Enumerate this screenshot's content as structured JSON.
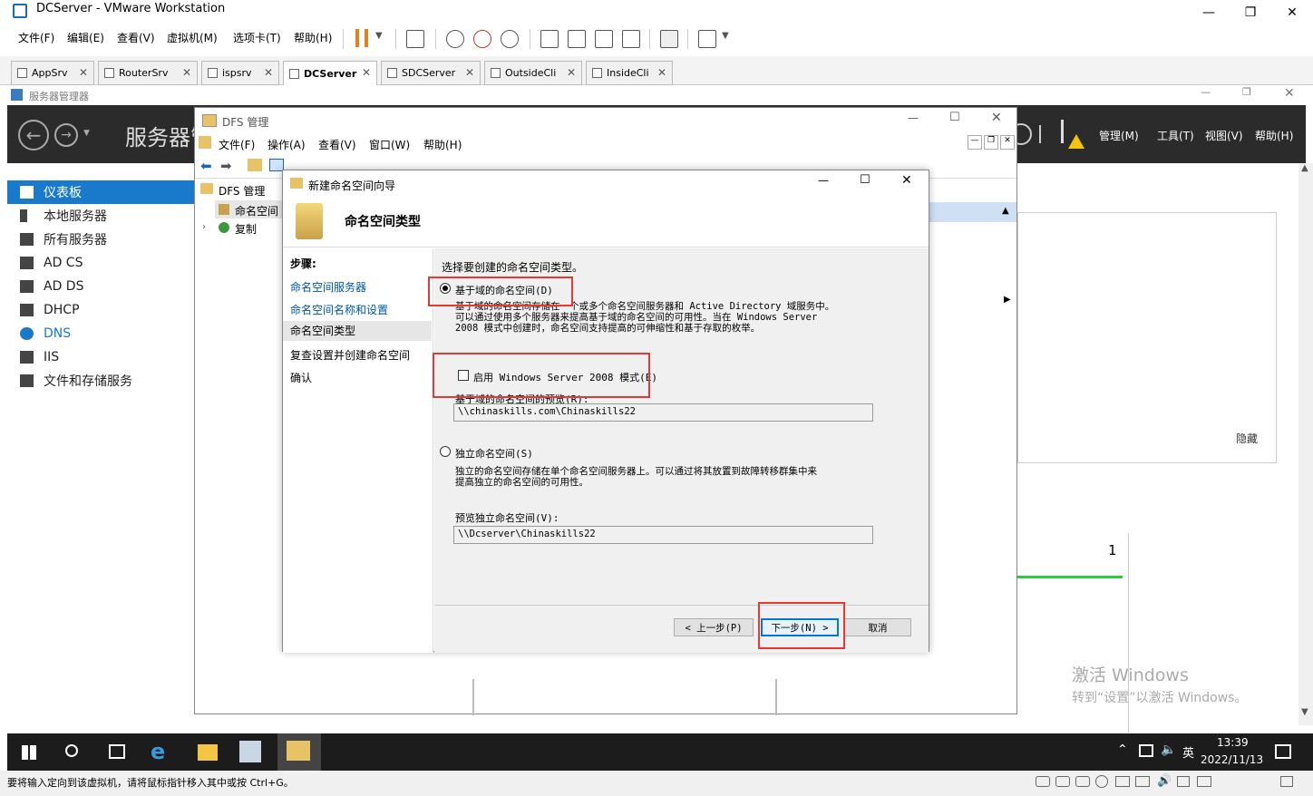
{
  "vmware": {
    "title": "DCServer - VMware Workstation",
    "menu": [
      "文件(F)",
      "编辑(E)",
      "查看(V)",
      "虚拟机(M)",
      "选项卡(T)",
      "帮助(H)"
    ],
    "tabs": [
      "AppSrv",
      "RouterSrv",
      "ispsrv",
      "DCServer",
      "SDCServer",
      "OutsideCli",
      "InsideCli"
    ],
    "active_tab": "DCServer",
    "status": "要将输入定向到该虚拟机，请将鼠标指针移入其中或按 Ctrl+G。"
  },
  "server_manager": {
    "window_title": "服务器管理器",
    "header_title": "服务器管",
    "menu": [
      "管理(M)",
      "工具(T)",
      "视图(V)",
      "帮助(H)"
    ],
    "sidebar": [
      "仪表板",
      "本地服务器",
      "所有服务器",
      "AD CS",
      "AD DS",
      "DHCP",
      "DNS",
      "IIS",
      "文件和存储服务"
    ],
    "selected": "仪表板",
    "hide_label": "隐藏",
    "count": "1"
  },
  "dfs": {
    "title": "DFS 管理",
    "menu": [
      "文件(F)",
      "操作(A)",
      "查看(V)",
      "窗口(W)",
      "帮助(H)"
    ],
    "tree": {
      "root": "DFS 管理",
      "namespace": "命名空间",
      "replication": "复制"
    }
  },
  "wizard": {
    "title": "新建命名空间向导",
    "heading": "命名空间类型",
    "steps_label": "步骤:",
    "steps": [
      "命名空间服务器",
      "命名空间名称和设置",
      "命名空间类型",
      "复查设置并创建命名空间",
      "确认"
    ],
    "current_step": "命名空间类型",
    "prompt": "选择要创建的命名空间类型。",
    "domain_option": "基于域的命名空间(D)",
    "domain_desc1": "基于域的命名空间存储在一个或多个命名空间服务器和 Active Directory 域服务中。",
    "domain_desc2": "可以通过使用多个服务器来提高基于域的命名空间的可用性。当在 Windows Server",
    "domain_desc3": "2008 模式中创建时，命名空间支持提高的可伸缩性和基于存取的枚举。",
    "ws2008_option": "启用 Windows Server 2008 模式(E)",
    "domain_preview_label": "基于域的命名空间的预览(R):",
    "domain_preview": "\\\\chinaskills.com\\Chinaskills22",
    "standalone_option": "独立命名空间(S)",
    "standalone_desc1": "独立的命名空间存储在单个命名空间服务器上。可以通过将其放置到故障转移群集中来",
    "standalone_desc2": "提高独立的命名空间的可用性。",
    "standalone_preview_label": "预览独立命名空间(V):",
    "standalone_preview": "\\\\Dcserver\\Chinaskills22",
    "back": "< 上一步(P)",
    "next": "下一步(N) >",
    "cancel": "取消"
  },
  "taskbar": {
    "ime": "英",
    "time": "13:39",
    "date": "2022/11/13"
  },
  "watermark": {
    "line1": "激活 Windows",
    "line2": "转到“设置”以激活 Windows。"
  },
  "colors": {
    "accent": "#1979ca",
    "highlight": "#e53935",
    "header": "#2b2b2b"
  }
}
